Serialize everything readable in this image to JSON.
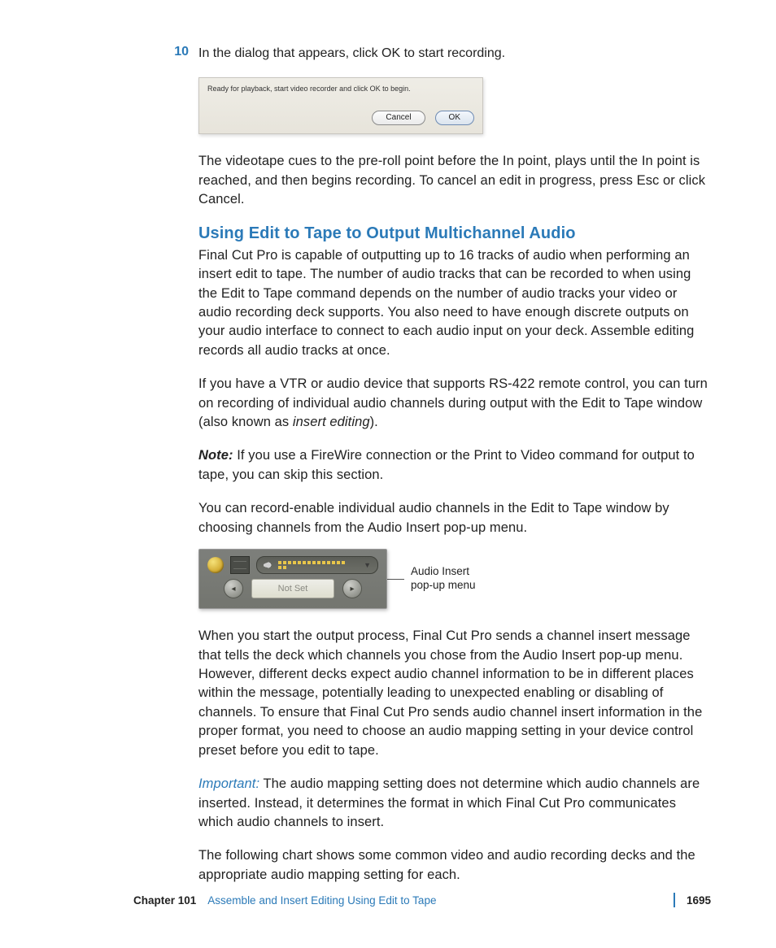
{
  "step": {
    "number": "10",
    "text": "In the dialog that appears, click OK to start recording."
  },
  "dialog": {
    "message": "Ready for playback, start video recorder and click OK to begin.",
    "cancel": "Cancel",
    "ok": "OK"
  },
  "para1": "The videotape cues to the pre-roll point before the In point, plays until the In point is reached, and then begins recording. To cancel an edit in progress, press Esc or click Cancel.",
  "heading": "Using Edit to Tape to Output Multichannel Audio",
  "para2": "Final Cut Pro is capable of outputting up to 16 tracks of audio when performing an insert edit to tape. The number of audio tracks that can be recorded to when using the Edit to Tape command depends on the number of audio tracks your video or audio recording deck supports. You also need to have enough discrete outputs on your audio interface to connect to each audio input on your deck. Assemble editing records all audio tracks at once.",
  "para3_a": "If you have a VTR or audio device that supports RS-422 remote control, you can turn on recording of individual audio channels during output with the Edit to Tape window (also known as ",
  "para3_b": "insert editing",
  "para3_c": ").",
  "note_label": "Note:",
  "note_text": "  If you use a FireWire connection or the Print to Video command for output to tape, you can skip this section.",
  "para4": "You can record-enable individual audio channels in the Edit to Tape window by choosing channels from the Audio Insert pop-up menu.",
  "figure": {
    "field": "Not Set",
    "callout_l1": "Audio Insert",
    "callout_l2": "pop-up menu"
  },
  "para5": "When you start the output process, Final Cut Pro sends a channel insert message that tells the deck which channels you chose from the Audio Insert pop-up menu. However, different decks expect audio channel information to be in different places within the message, potentially leading to unexpected enabling or disabling of channels. To ensure that Final Cut Pro sends audio channel insert information in the proper format, you need to choose an audio mapping setting in your device control preset before you edit to tape.",
  "important_label": "Important:",
  "important_text": "  The audio mapping setting does not determine which audio channels are inserted. Instead, it determines the format in which Final Cut Pro communicates which audio channels to insert.",
  "para6": "The following chart shows some common video and audio recording decks and the appropriate audio mapping setting for each.",
  "footer": {
    "chapter": "Chapter 101",
    "title": "Assemble and Insert Editing Using Edit to Tape",
    "page": "1695"
  }
}
